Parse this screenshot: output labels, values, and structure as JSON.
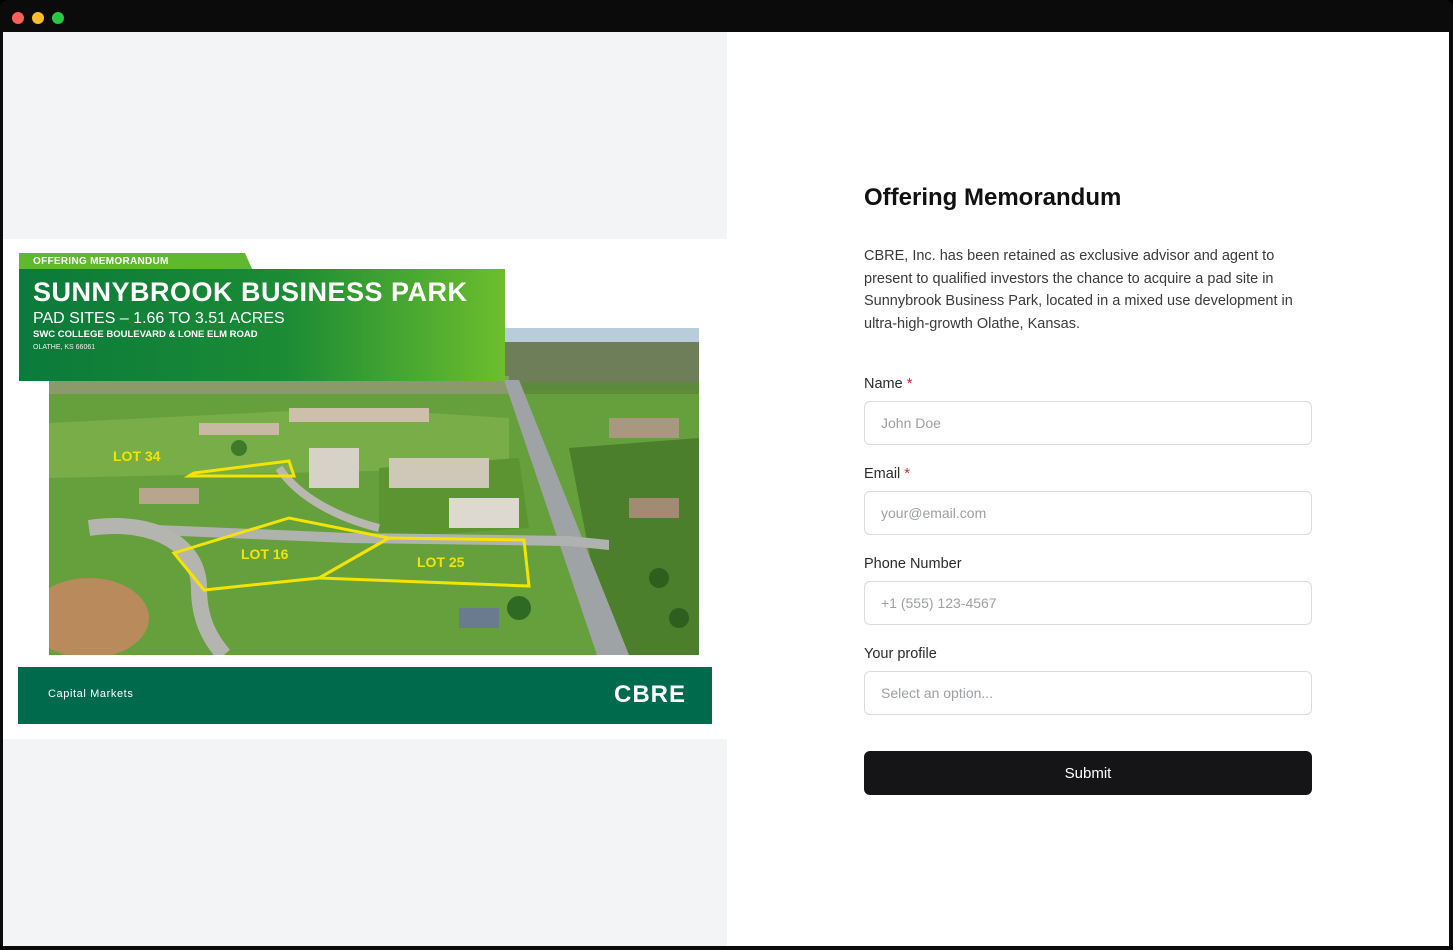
{
  "brochure": {
    "tag": "OFFERING MEMORANDUM",
    "title": "SUNNYBROOK BUSINESS PARK",
    "subtitle": "PAD SITES – 1.66 TO 3.51 ACRES",
    "address": "SWC COLLEGE BOULEVARD & LONE ELM ROAD",
    "city": "OLATHE, KS 66061",
    "lots": [
      "LOT 34",
      "LOT 16",
      "LOT 25"
    ],
    "footer_label": "Capital Markets",
    "logo": "CBRE",
    "brand_color": "#006a4d",
    "accent_color": "#5fb82f",
    "lot_outline_color": "#f5e400"
  },
  "form": {
    "title": "Offering Memorandum",
    "description": "CBRE, Inc. has been retained as exclusive advisor and agent to present to qualified investors the chance to acquire a pad site in Sunnybrook Business Park, located in a mixed use development in ultra-high-growth Olathe, Kansas.",
    "required_marker": "*",
    "name": {
      "label": "Name",
      "placeholder": "John Doe"
    },
    "email": {
      "label": "Email",
      "placeholder": "your@email.com"
    },
    "phone": {
      "label": "Phone Number",
      "placeholder": "+1 (555) 123-4567"
    },
    "profile": {
      "label": "Your profile",
      "selected": "Select an option..."
    },
    "submit_label": "Submit"
  }
}
